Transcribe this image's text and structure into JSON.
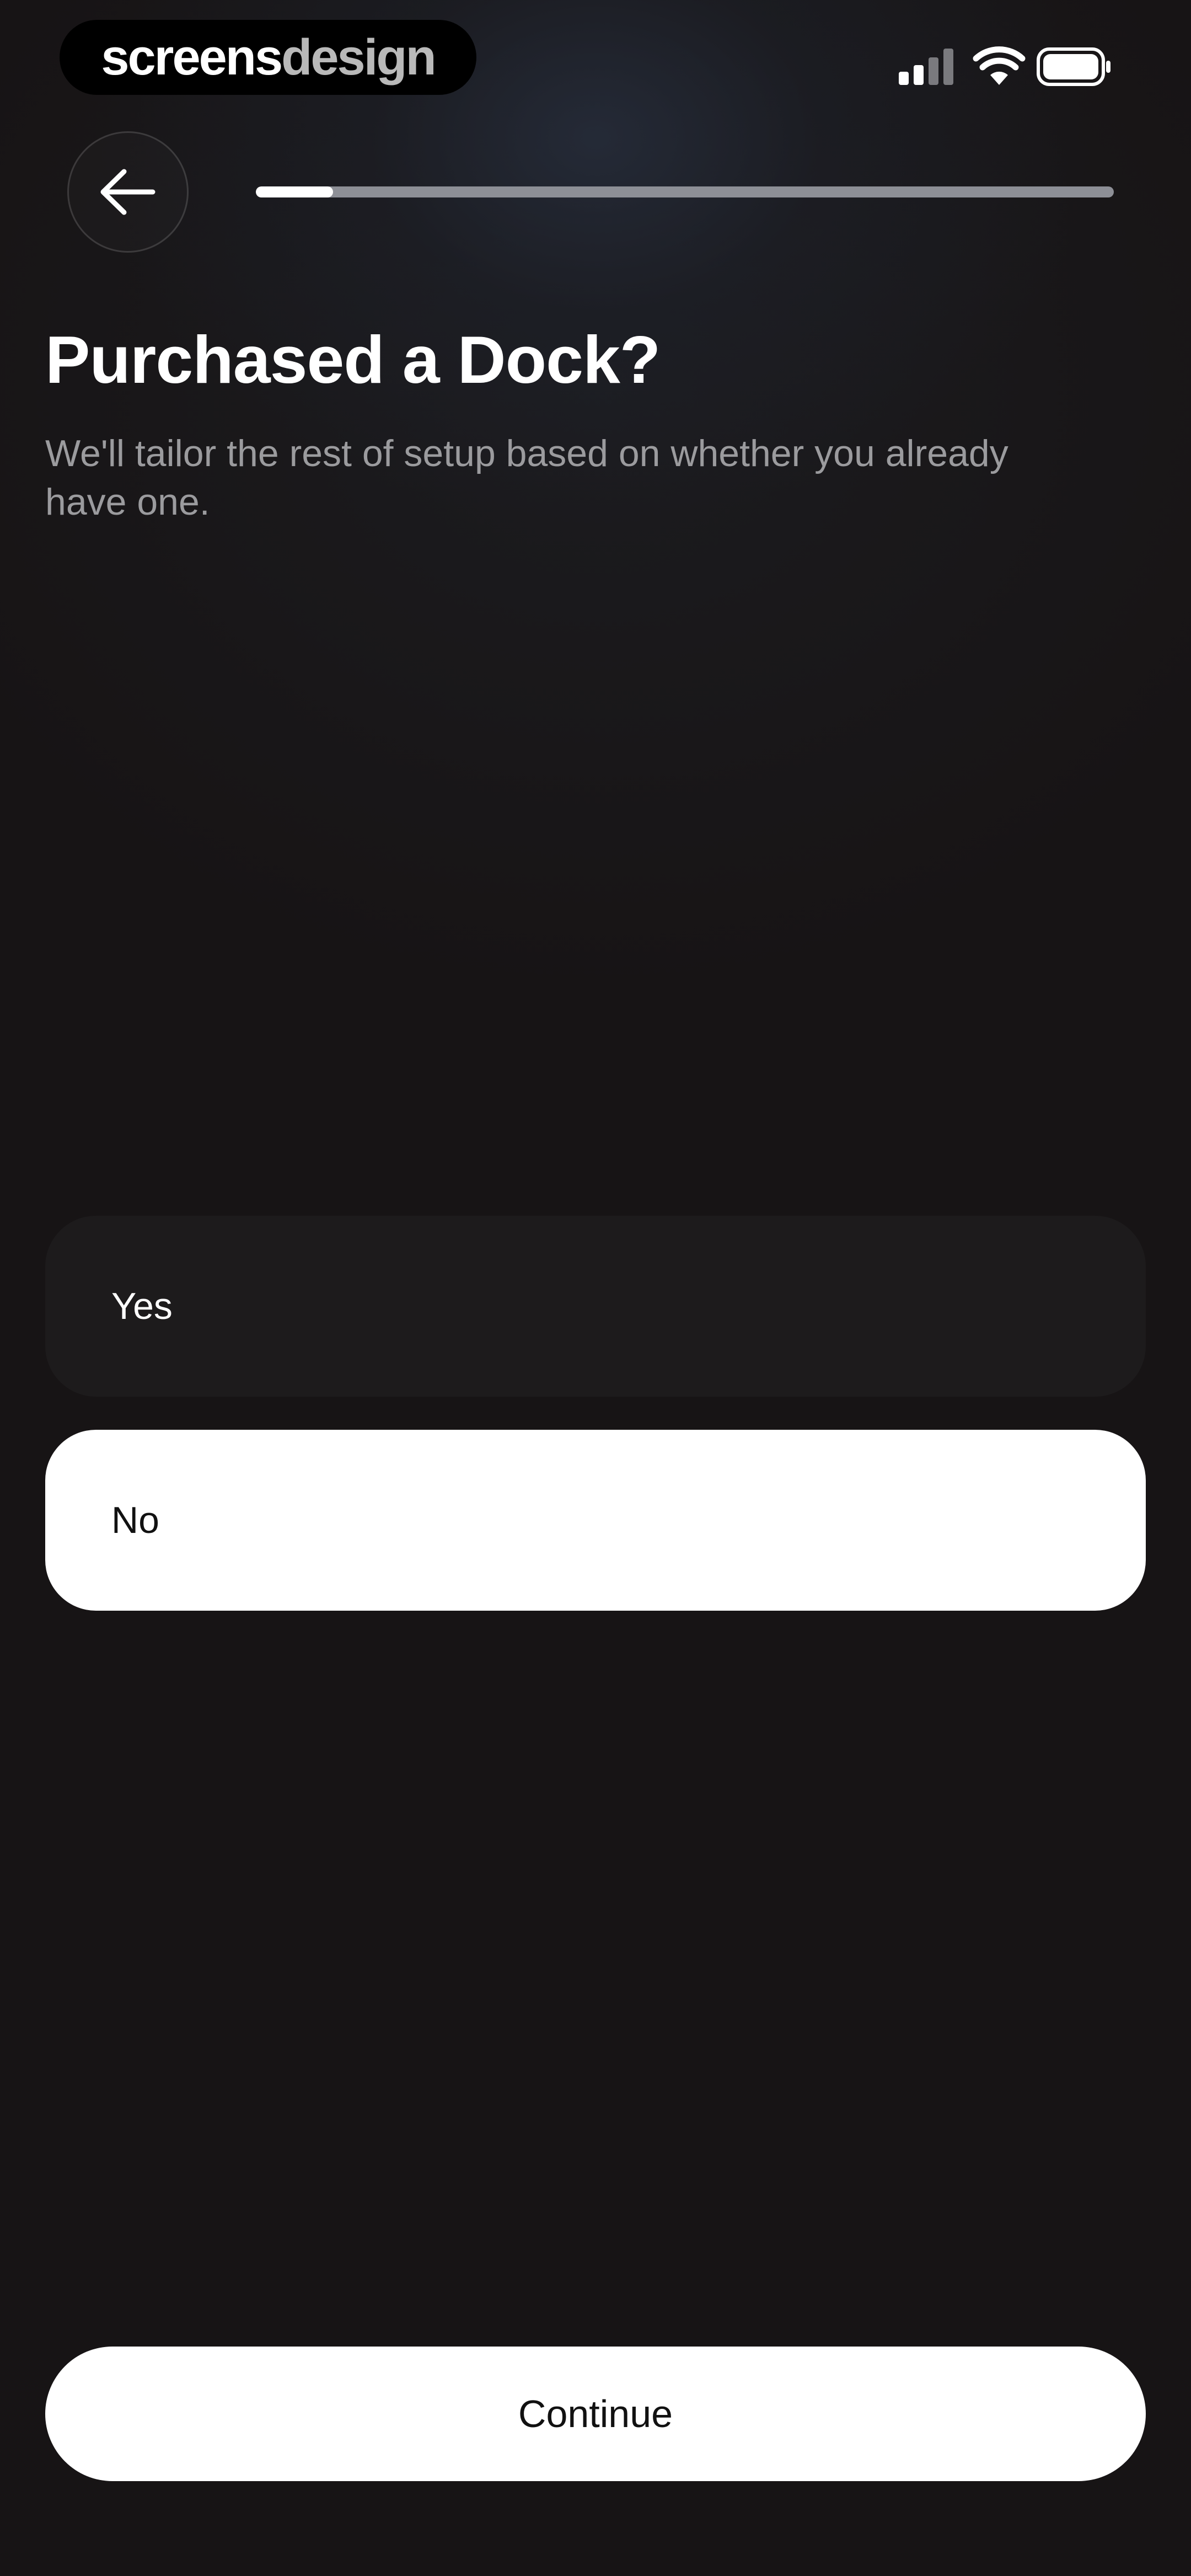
{
  "status_bar": {
    "brand_primary": "screens",
    "brand_secondary": "design",
    "signal_icon": "signal-bars-icon",
    "wifi_icon": "wifi-icon",
    "battery_icon": "battery-icon"
  },
  "nav": {
    "back_icon": "arrow-left-icon",
    "progress_fraction": 0.09
  },
  "header": {
    "title": "Purchased a Dock?",
    "subtitle": "We'll tailor the rest of setup based on whether you already have one."
  },
  "options": {
    "yes_label": "Yes",
    "no_label": "No",
    "selected": "No"
  },
  "footer": {
    "continue_label": "Continue"
  },
  "colors": {
    "background": "#171415",
    "option_unselected": "#1d1b1c",
    "option_selected": "#ffffff",
    "progress_track": "#8d8f96",
    "progress_fill": "#ffffff",
    "subtitle_text": "#9b9b9e"
  }
}
